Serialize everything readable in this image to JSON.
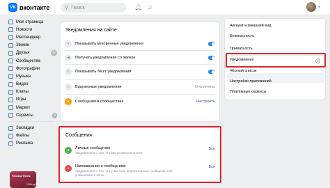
{
  "header": {
    "logo_text": "вконтакте",
    "logo_mark": "VK",
    "search_placeholder": "Поиск",
    "icons": [
      "bell-icon",
      "music-icon",
      "chevron-down-icon"
    ]
  },
  "sidebar": {
    "items": [
      {
        "label": "Моя страница",
        "icon": "user-icon"
      },
      {
        "label": "Новости",
        "icon": "news-icon"
      },
      {
        "label": "Мессенджер",
        "icon": "chat-icon"
      },
      {
        "label": "Звонки",
        "icon": "phone-icon"
      },
      {
        "label": "Друзья",
        "icon": "friends-icon",
        "badge": "49"
      },
      {
        "label": "Сообщества",
        "icon": "community-icon"
      },
      {
        "label": "Фотографии",
        "icon": "photo-icon"
      },
      {
        "label": "Музыка",
        "icon": "music-icon"
      },
      {
        "label": "Видео",
        "icon": "video-icon"
      },
      {
        "label": "Клипы",
        "icon": "clips-icon"
      },
      {
        "label": "Игры",
        "icon": "games-icon"
      },
      {
        "label": "Маркет",
        "icon": "market-icon"
      },
      {
        "label": "Сервисы",
        "icon": "services-icon",
        "badge": "6"
      }
    ],
    "secondary": [
      {
        "label": "Закладки",
        "icon": "bookmark-icon"
      },
      {
        "label": "Файлы",
        "icon": "file-icon"
      },
      {
        "label": "Реклама",
        "icon": "ads-icon"
      }
    ],
    "ad": {
      "title": "Реклама Фолек",
      "price": "1900 руб"
    }
  },
  "site_notifications": {
    "title": "Уведомления на сайте",
    "rows": [
      {
        "label": "Показывать мгновенные уведомления",
        "icon": "lightning-icon",
        "toggle": true
      },
      {
        "label": "Получать уведомления со звуком",
        "icon": "sound-icon",
        "toggle": true
      },
      {
        "label": "Показывать текст уведомлений",
        "icon": "text-icon",
        "toggle": true
      },
      {
        "label": "Браузерные уведомления",
        "icon": "browser-icon",
        "value": "Отключены"
      },
      {
        "label": "Сообщения в сообществах",
        "icon": "community-icon",
        "link": "Настроить"
      }
    ]
  },
  "messages": {
    "title": "Сообщения",
    "rows": [
      {
        "name": "Личные сообщения",
        "desc": "Уведомления о том, что вас упомянули в чате",
        "value": "Все",
        "icon": "chat-icon"
      },
      {
        "name": "Напоминания о сообщениях",
        "desc": "Уведомления о том, что у вас есть непрочитанные сообщения или упоминания в чатах",
        "value": "Все",
        "icon": "reminder-icon"
      }
    ]
  },
  "settings_menu": {
    "items": [
      "Аккаунт и внешний вид",
      "Безопасность",
      "Приватность",
      "Уведомления",
      "Чёрный список",
      "Настройки приложений",
      "Платёжные сервисы"
    ],
    "active": "Уведомления"
  },
  "colors": {
    "accent": "#2688eb",
    "highlight": "#e0242d",
    "background": "#edeef0"
  }
}
